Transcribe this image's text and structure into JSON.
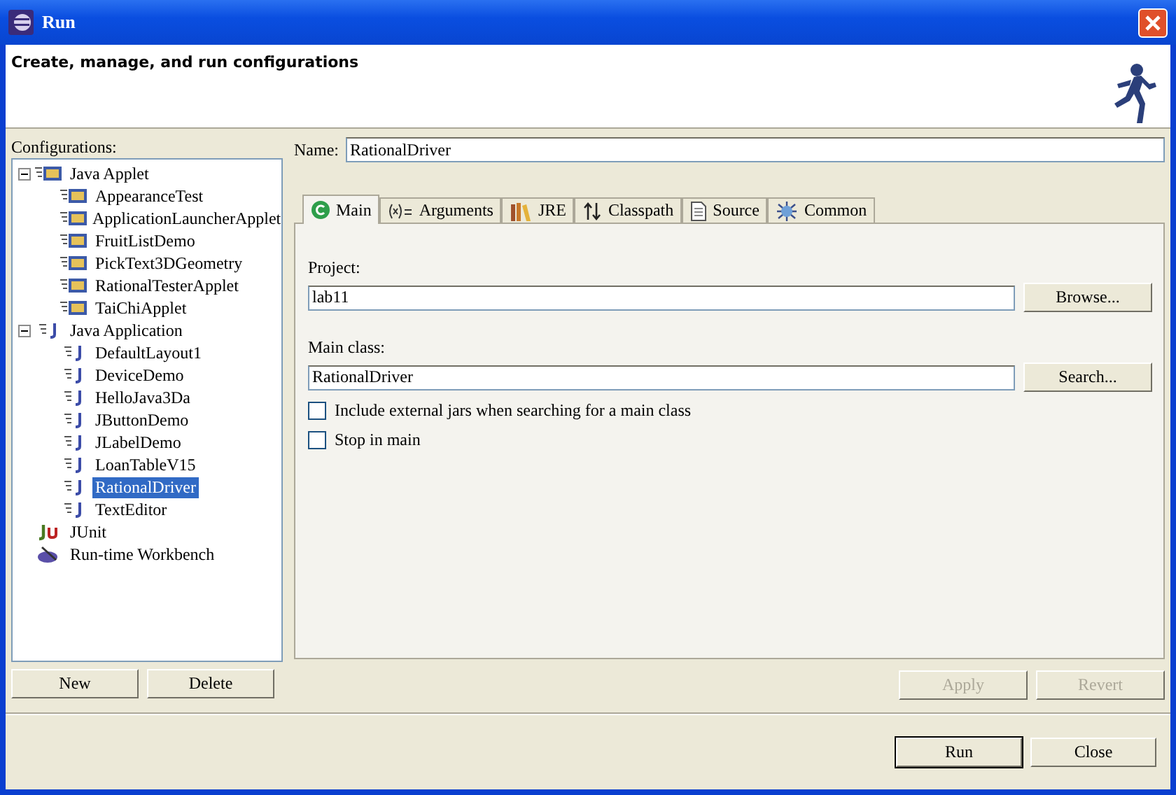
{
  "window": {
    "title": "Run"
  },
  "header": {
    "text": "Create, manage, and run configurations"
  },
  "configurations": {
    "label": "Configurations:",
    "tree": [
      {
        "label": "Java Applet",
        "kind": "applet",
        "expanded": true,
        "selected": false,
        "children": [
          {
            "label": "AppearanceTest",
            "kind": "applet",
            "selected": false
          },
          {
            "label": "ApplicationLauncherApplet",
            "kind": "applet",
            "selected": false
          },
          {
            "label": "FruitListDemo",
            "kind": "applet",
            "selected": false
          },
          {
            "label": "PickText3DGeometry",
            "kind": "applet",
            "selected": false
          },
          {
            "label": "RationalTesterApplet",
            "kind": "applet",
            "selected": false
          },
          {
            "label": "TaiChiApplet",
            "kind": "applet",
            "selected": false
          }
        ]
      },
      {
        "label": "Java Application",
        "kind": "app",
        "expanded": true,
        "selected": false,
        "children": [
          {
            "label": "DefaultLayout1",
            "kind": "app",
            "selected": false
          },
          {
            "label": "DeviceDemo",
            "kind": "app",
            "selected": false
          },
          {
            "label": "HelloJava3Da",
            "kind": "app",
            "selected": false
          },
          {
            "label": "JButtonDemo",
            "kind": "app",
            "selected": false
          },
          {
            "label": "JLabelDemo",
            "kind": "app",
            "selected": false
          },
          {
            "label": "LoanTableV15",
            "kind": "app",
            "selected": false
          },
          {
            "label": "RationalDriver",
            "kind": "app",
            "selected": true
          },
          {
            "label": "TextEditor",
            "kind": "app",
            "selected": false
          }
        ]
      },
      {
        "label": "JUnit",
        "kind": "junit",
        "selected": false
      },
      {
        "label": "Run-time Workbench",
        "kind": "workbench",
        "selected": false
      }
    ],
    "buttons": [
      {
        "label": "New",
        "disabled": false
      },
      {
        "label": "Delete",
        "disabled": false
      }
    ]
  },
  "name": {
    "label": "Name:",
    "value": "RationalDriver"
  },
  "tabs": [
    {
      "label": "Main",
      "kind": "main",
      "selected": true
    },
    {
      "label": "Arguments",
      "kind": "arguments",
      "selected": false
    },
    {
      "label": "JRE",
      "kind": "jre",
      "selected": false
    },
    {
      "label": "Classpath",
      "kind": "classpath",
      "selected": false
    },
    {
      "label": "Source",
      "kind": "source",
      "selected": false
    },
    {
      "label": "Common",
      "kind": "common",
      "selected": false
    }
  ],
  "main_tab": {
    "project": {
      "label": "Project:",
      "value": "lab11",
      "button": "Browse..."
    },
    "main_class": {
      "label": "Main class:",
      "value": "RationalDriver",
      "button": "Search..."
    },
    "options": [
      {
        "label": "Include external jars when searching for a main class",
        "checked": false
      },
      {
        "label": "Stop in main",
        "checked": false
      }
    ]
  },
  "config_buttons": [
    {
      "label": "Apply",
      "disabled": true
    },
    {
      "label": "Revert",
      "disabled": true
    }
  ],
  "dialog_buttons": [
    {
      "label": "Run",
      "disabled": false,
      "default": true
    },
    {
      "label": "Close",
      "disabled": false,
      "default": false
    }
  ]
}
